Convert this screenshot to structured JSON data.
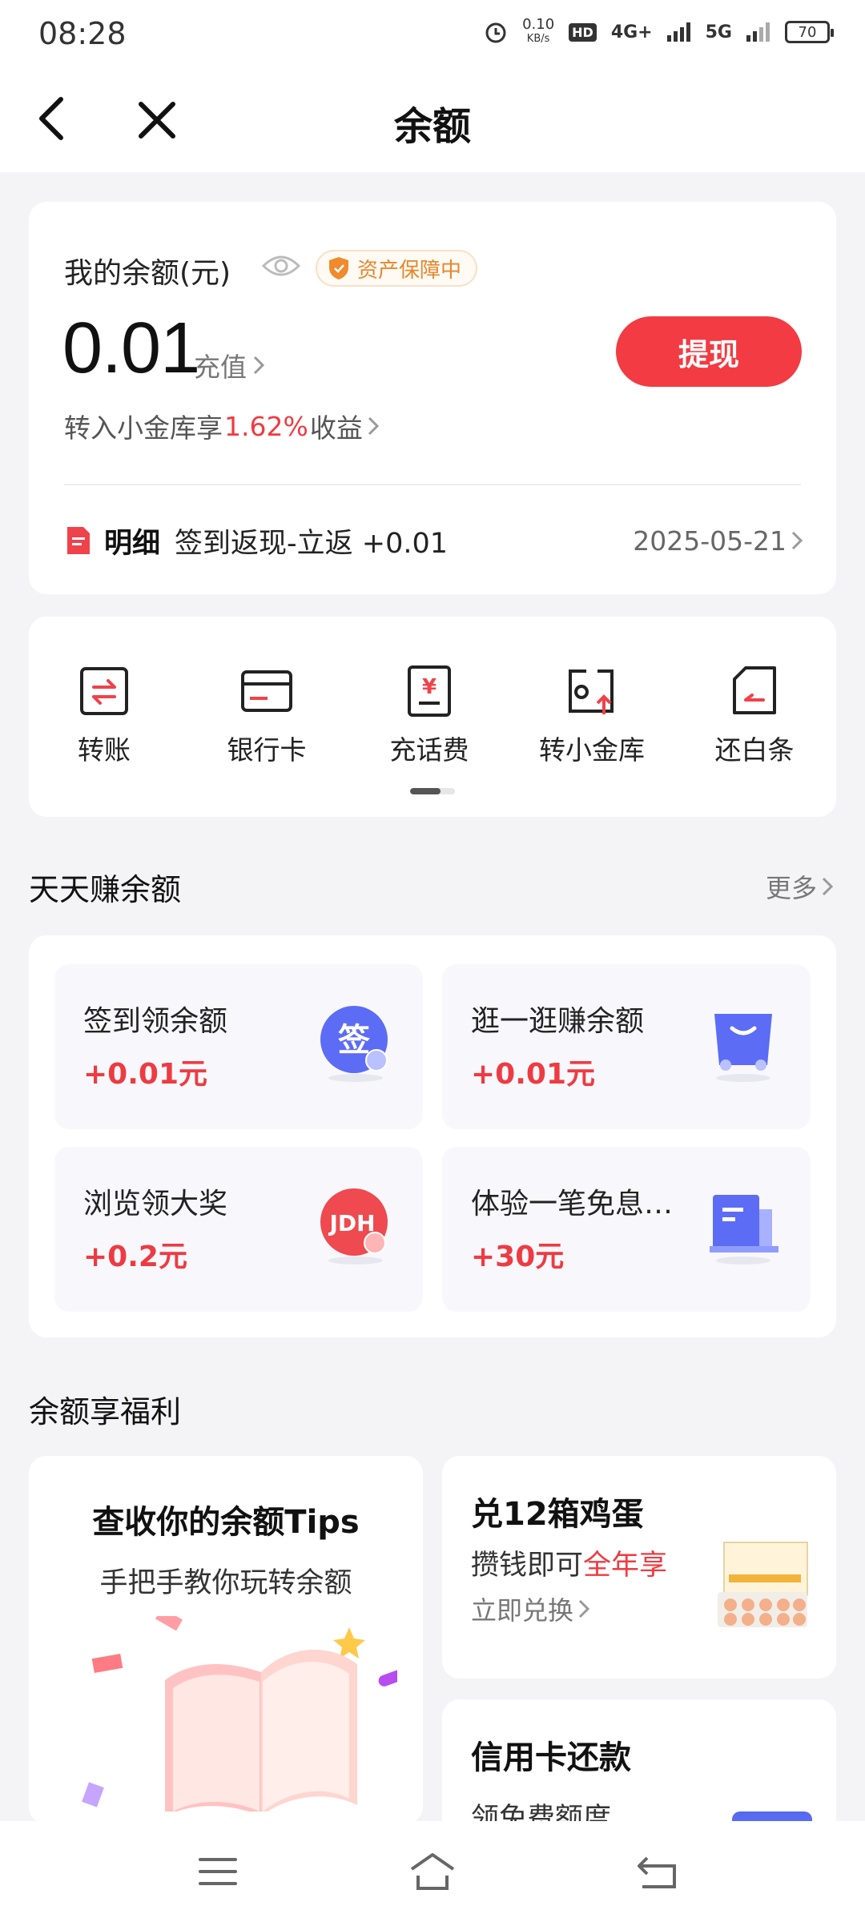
{
  "status": {
    "time": "08:28",
    "speed": "0.10",
    "speed_unit": "KB/s",
    "hd": "HD",
    "sim1": "1",
    "sim2": "2",
    "net1": "4G+",
    "net2": "5G",
    "battery": "70"
  },
  "header": {
    "title": "余额"
  },
  "balance": {
    "label": "我的余额(元)",
    "badge": "资产保障中",
    "amount": "0.01",
    "recharge": "充值",
    "withdraw": "提现",
    "transfer_prefix": "转入小金库享",
    "transfer_rate": "1.62%",
    "transfer_suffix": "收益",
    "detail_title": "明细",
    "detail_text": "签到返现-立返 +0.01",
    "detail_date": "2025-05-21"
  },
  "actions": [
    {
      "label": "转账",
      "icon": "transfer-icon"
    },
    {
      "label": "银行卡",
      "icon": "bank-card-icon"
    },
    {
      "label": "充话费",
      "icon": "phone-bill-icon"
    },
    {
      "label": "转小金库",
      "icon": "vault-icon"
    },
    {
      "label": "还白条",
      "icon": "repay-icon"
    }
  ],
  "earn": {
    "title": "天天赚余额",
    "more": "更多",
    "tiles": [
      {
        "title": "签到领余额",
        "value": "+0.01元",
        "icon": "sign-in-icon",
        "icon_text": "签"
      },
      {
        "title": "逛一逛赚余额",
        "value": "+0.01元",
        "icon": "shopping-bag-icon"
      },
      {
        "title": "浏览领大奖",
        "value": "+0.2元",
        "icon": "jdh-icon",
        "icon_text": "JDH"
      },
      {
        "title": "体验一笔免息…",
        "value": "+30元",
        "icon": "document-icon"
      }
    ]
  },
  "welfare": {
    "title": "余额享福利",
    "tips_title": "查收你的余额Tips",
    "tips_sub": "手把手教你玩转余额",
    "egg_title": "兑12箱鸡蛋",
    "egg_sub_prefix": "攒钱即可",
    "egg_sub_highlight": "全年享",
    "egg_link": "立即兑换",
    "credit_title": "信用卡还款",
    "credit_sub": "领免费额度"
  },
  "colors": {
    "accent": "#f23b42",
    "badge": "#e6872b",
    "bg": "#f4f4f7"
  }
}
